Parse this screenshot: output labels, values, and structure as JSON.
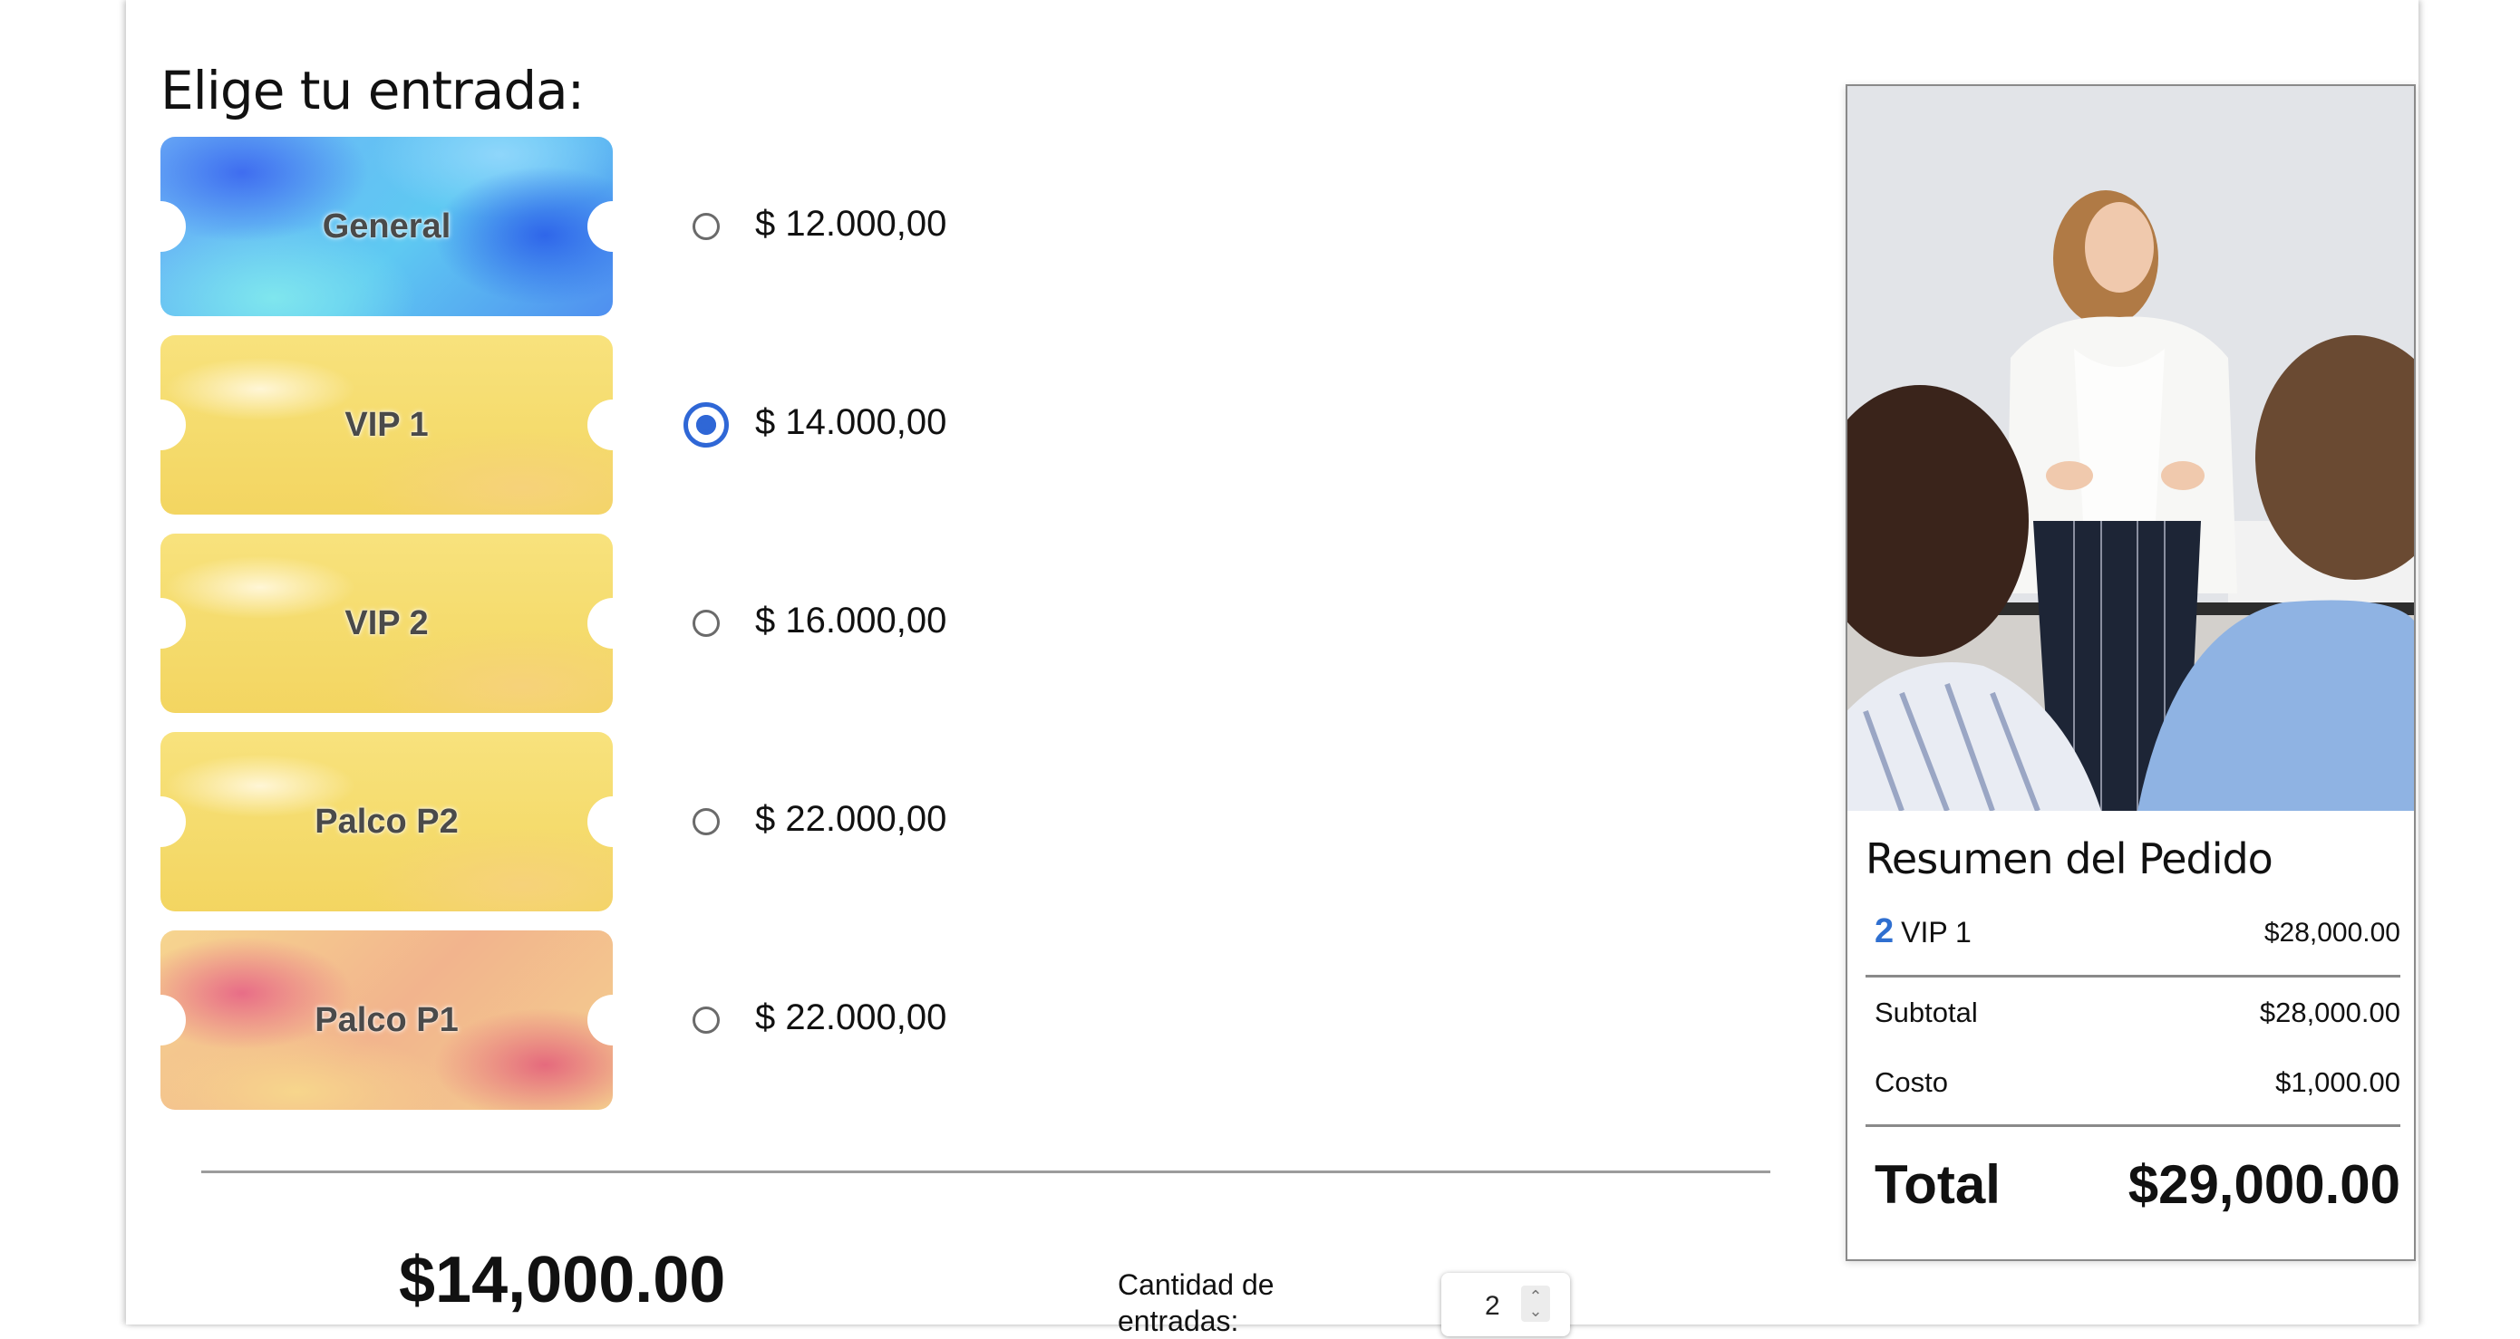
{
  "heading": "Elige tu entrada:",
  "tickets": [
    {
      "label": "General",
      "price": "$ 12.000,00",
      "selected": false,
      "style": "blue"
    },
    {
      "label": "VIP 1",
      "price": "$ 14.000,00",
      "selected": true,
      "style": "yellow"
    },
    {
      "label": "VIP 2",
      "price": "$ 16.000,00",
      "selected": false,
      "style": "yellow"
    },
    {
      "label": "Palco P2",
      "price": "$ 22.000,00",
      "selected": false,
      "style": "yellow"
    },
    {
      "label": "Palco P1",
      "price": "$ 22.000,00",
      "selected": false,
      "style": "pink"
    }
  ],
  "selected_price": "$14,000.00",
  "quantity": {
    "label": "Cantidad de entradas:",
    "value": "2"
  },
  "summary": {
    "title": "Resumen del Pedido",
    "item": {
      "qty": "2",
      "name": "VIP 1",
      "amount": "$28,000.00"
    },
    "subtotal_label": "Subtotal",
    "subtotal_value": "$28,000.00",
    "cost_label": "Costo",
    "cost_value": "$1,000.00",
    "total_label": "Total",
    "total_value": "$29,000.00"
  },
  "colors": {
    "accent": "#2f67d6",
    "qty_accent": "#2f6fd0"
  }
}
